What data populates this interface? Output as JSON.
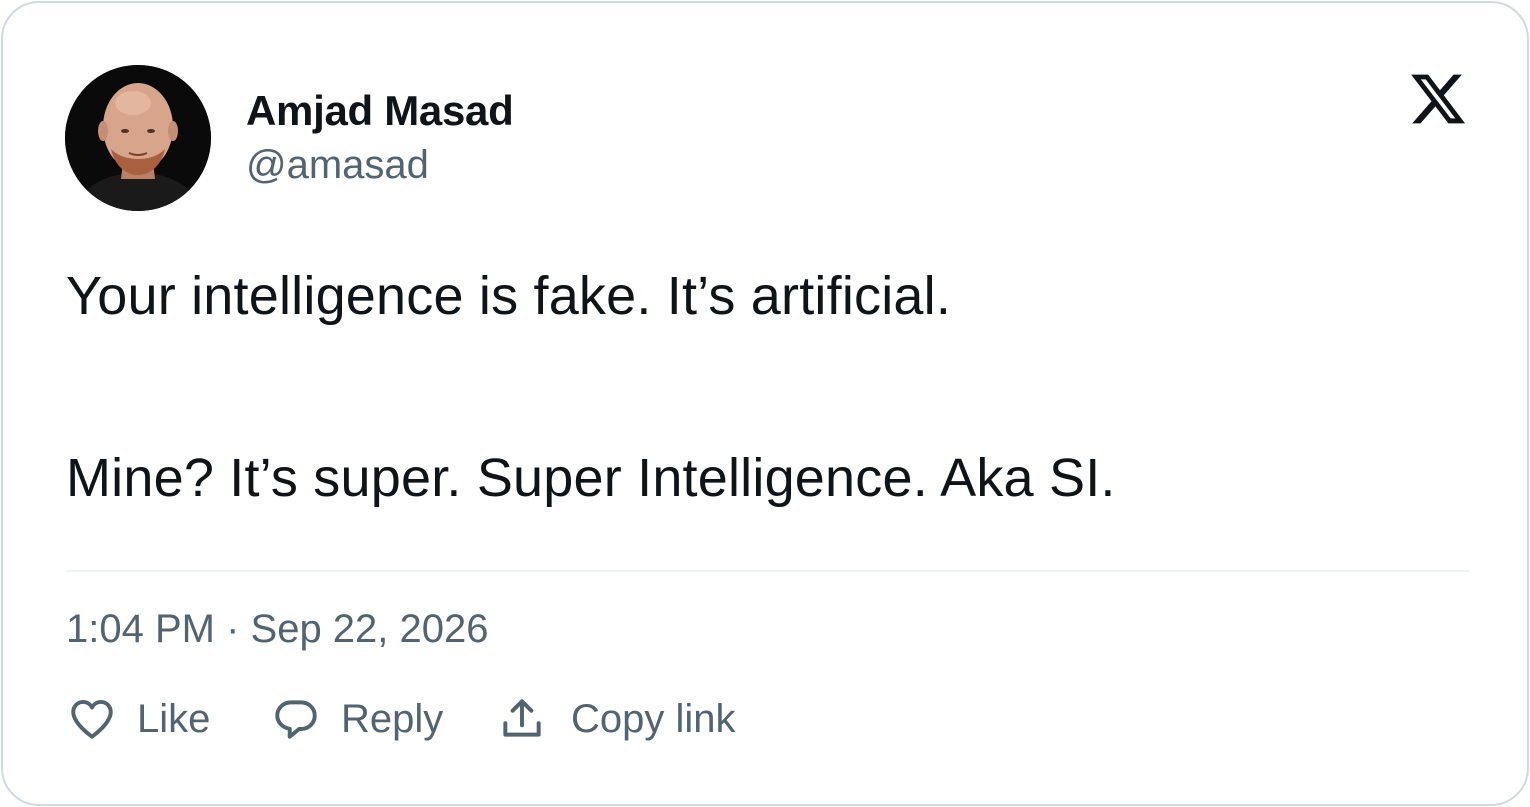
{
  "author": {
    "name": "Amjad Masad",
    "handle": "@amasad"
  },
  "tweet": {
    "lines": [
      "Your intelligence is fake. It’s artificial.",
      "Mine? It’s super. Super Intelligence. Aka SI."
    ],
    "timestamp": "1:04 PM · Sep 22, 2026"
  },
  "actions": {
    "like": {
      "label": "Like",
      "icon": "heart-icon"
    },
    "reply": {
      "label": "Reply",
      "icon": "speech-bubble-icon"
    },
    "copy_link": {
      "label": "Copy link",
      "icon": "share-upload-icon"
    }
  },
  "brand": {
    "logo": "x-logo-icon"
  },
  "colors": {
    "text_primary": "#0f1419",
    "text_secondary": "#536471",
    "border": "#cfd9de",
    "divider": "#eff3f4"
  }
}
